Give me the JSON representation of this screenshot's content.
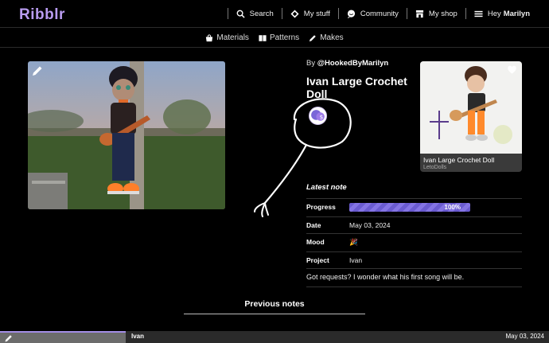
{
  "app": {
    "logo": "Ribblr"
  },
  "nav": {
    "search": "Search",
    "my_stuff": "My stuff",
    "community": "Community",
    "my_shop": "My shop",
    "greeting_prefix": "Hey",
    "user": "Marilyn"
  },
  "subnav": {
    "materials": "Materials",
    "patterns": "Patterns",
    "makes": "Makes"
  },
  "make": {
    "by_prefix": "By",
    "author": "@HookedByMarilyn",
    "title": "Ivan Large Crochet Doll"
  },
  "pattern_card": {
    "title": "Ivan Large Crochet Doll",
    "author": "LetoDolls"
  },
  "latest_note": {
    "heading": "Latest note",
    "progress_label": "Progress",
    "progress_value": "100%",
    "progress_fraction": 1.0,
    "date_label": "Date",
    "date_value": "May 03, 2024",
    "mood_label": "Mood",
    "mood_value": "🎉",
    "project_label": "Project",
    "project_value": "Ivan",
    "note_text": "Got requests? I wonder what his first song will be."
  },
  "previous_notes": {
    "heading": "Previous notes",
    "items": [
      {
        "name": "Ivan",
        "date": "May 03, 2024"
      }
    ]
  },
  "colors": {
    "accent": "#b99cf0",
    "progress": "#7a6ae0"
  },
  "icons": [
    "search-icon",
    "diamond-icon",
    "chat-icon",
    "shop-icon",
    "menu-icon",
    "bag-icon",
    "book-icon",
    "pen-icon",
    "pencil-icon",
    "heart-icon"
  ]
}
